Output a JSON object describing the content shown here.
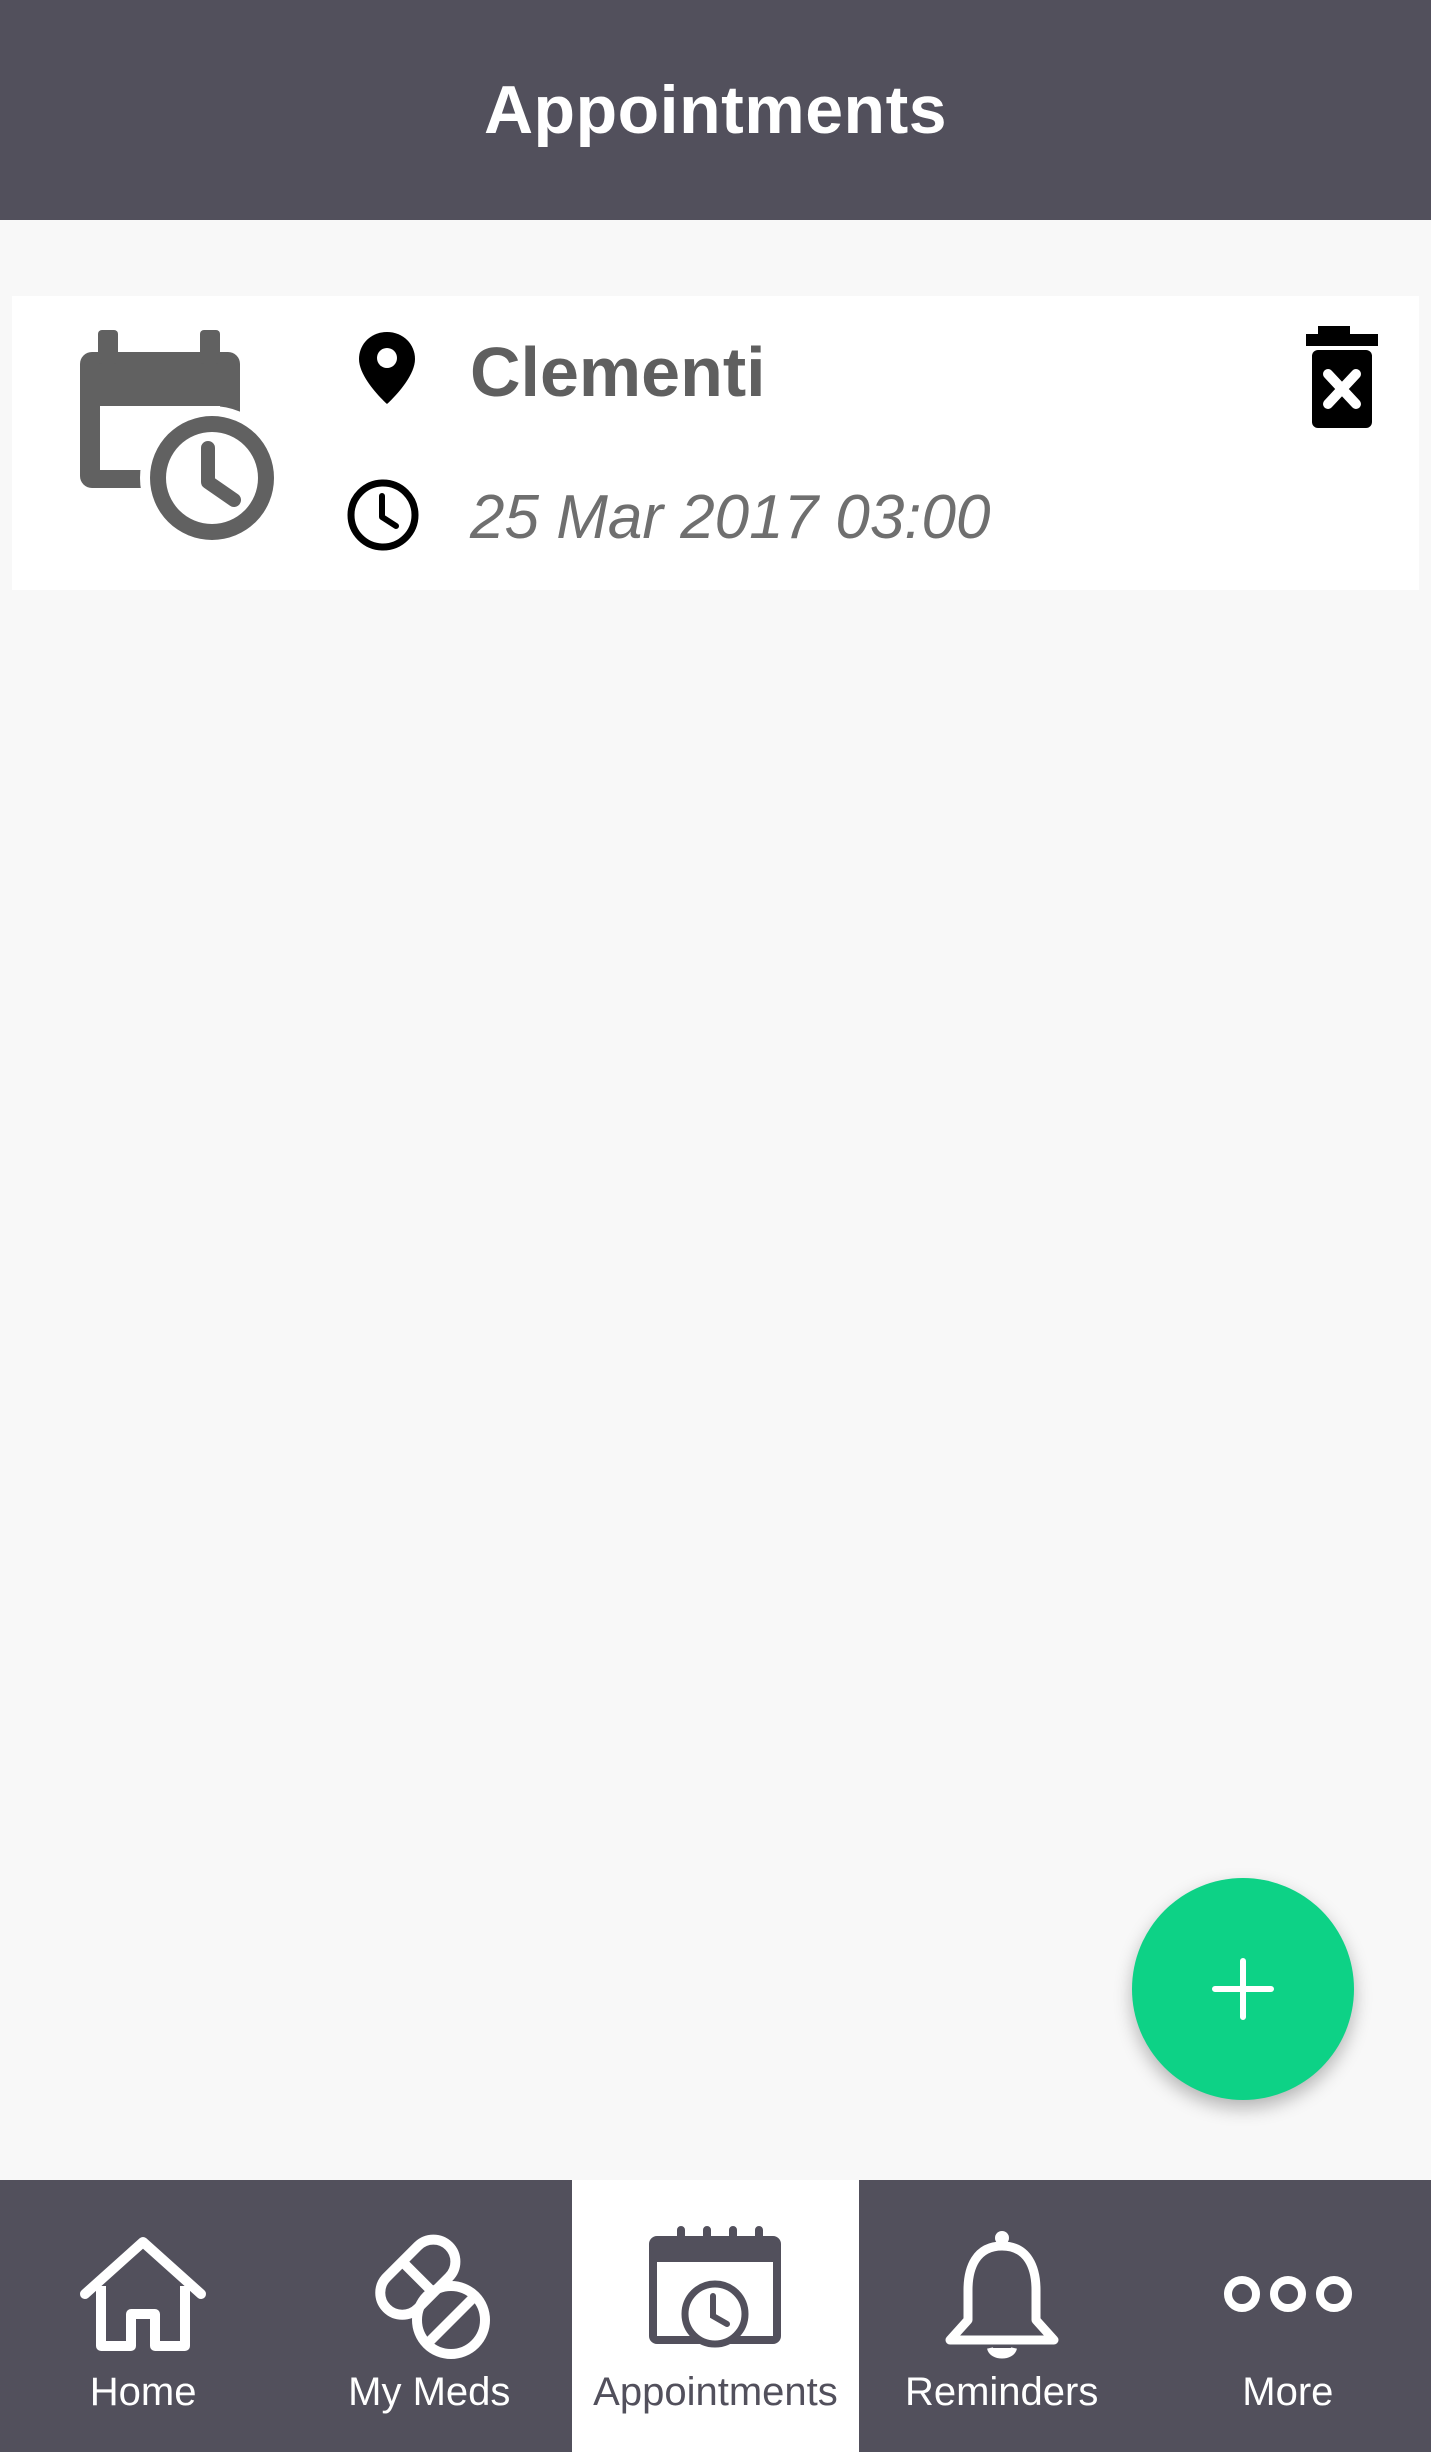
{
  "header": {
    "title": "Appointments"
  },
  "appointments": [
    {
      "location": "Clementi",
      "datetime": "25 Mar 2017 03:00",
      "icon": "calendar-clock-icon",
      "location_icon": "map-pin-icon",
      "time_icon": "clock-icon",
      "delete_icon": "trash-x-icon"
    }
  ],
  "fab": {
    "icon": "plus-icon"
  },
  "bottom_nav": {
    "items": [
      {
        "label": "Home",
        "icon": "home-icon",
        "active": false
      },
      {
        "label": "My Meds",
        "icon": "pill-icon",
        "active": false
      },
      {
        "label": "Appointments",
        "icon": "calendar-clock-icon",
        "active": true
      },
      {
        "label": "Reminders",
        "icon": "bell-icon",
        "active": false
      },
      {
        "label": "More",
        "icon": "more-dots-icon",
        "active": false
      }
    ]
  },
  "colors": {
    "header_bg": "#52505c",
    "accent_green": "#0dd286",
    "background": "#f8f8f8",
    "text_gray": "#5f5f5f"
  }
}
